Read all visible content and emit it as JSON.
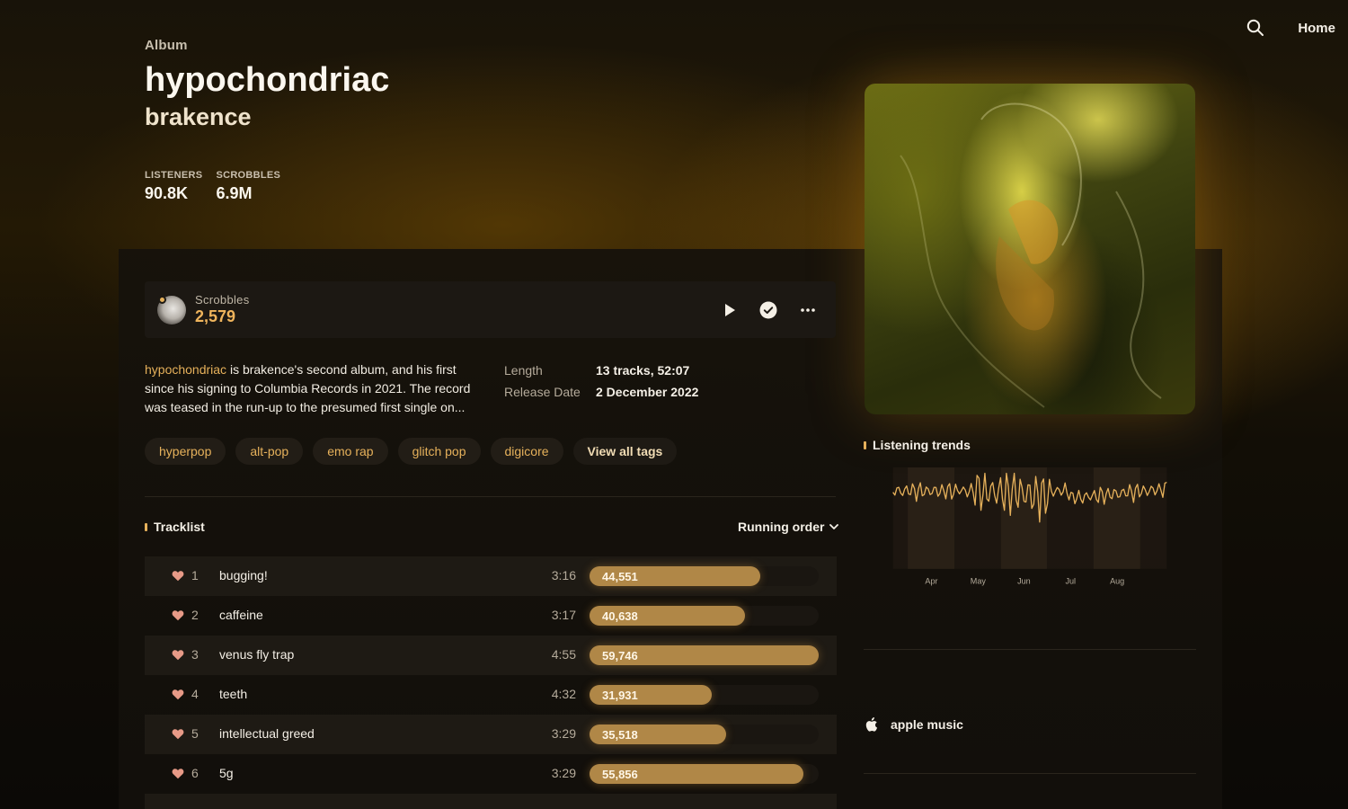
{
  "nav": {
    "home_label": "Home",
    "search_icon": "search-icon"
  },
  "album": {
    "eyebrow": "Album",
    "title": "hypochondriac",
    "artist": "brakence",
    "stats": [
      {
        "label": "LISTENERS",
        "value": "90.8K"
      },
      {
        "label": "SCROBBLES",
        "value": "6.9M"
      }
    ]
  },
  "user_scrobbles": {
    "label": "Scrobbles",
    "value": "2,579"
  },
  "description": {
    "highlight": "hypochondriac",
    "text": " is brakence's second album, and his first since his signing to Columbia Records in 2021. The record was teased in the run-up to the presumed first single on..."
  },
  "meta": [
    {
      "key": "Length",
      "value": "13 tracks, 52:07"
    },
    {
      "key": "Release Date",
      "value": "2 December 2022"
    }
  ],
  "tags": [
    "hyperpop",
    "alt-pop",
    "emo rap",
    "glitch pop",
    "digicore"
  ],
  "view_all_tags": "View all tags",
  "tracklist": {
    "title": "Tracklist",
    "sort_label": "Running order",
    "max_plays": 59746,
    "tracks": [
      {
        "num": "1",
        "name": "bugging!",
        "duration": "3:16",
        "plays": 44551,
        "plays_label": "44,551"
      },
      {
        "num": "2",
        "name": "caffeine",
        "duration": "3:17",
        "plays": 40638,
        "plays_label": "40,638"
      },
      {
        "num": "3",
        "name": "venus fly trap",
        "duration": "4:55",
        "plays": 59746,
        "plays_label": "59,746"
      },
      {
        "num": "4",
        "name": "teeth",
        "duration": "4:32",
        "plays": 31931,
        "plays_label": "31,931"
      },
      {
        "num": "5",
        "name": "intellectual greed",
        "duration": "3:29",
        "plays": 35518,
        "plays_label": "35,518"
      },
      {
        "num": "6",
        "name": "5g",
        "duration": "3:29",
        "plays": 55856,
        "plays_label": "55,856"
      }
    ]
  },
  "listening_trends": {
    "title": "Listening trends",
    "months": [
      "Apr",
      "May",
      "Jun",
      "Jul",
      "Aug"
    ]
  },
  "streaming": {
    "apple_music_label": "apple music"
  },
  "colors": {
    "accent": "#e6b15b",
    "bar": "#b08747",
    "background": "#0d0b08"
  }
}
